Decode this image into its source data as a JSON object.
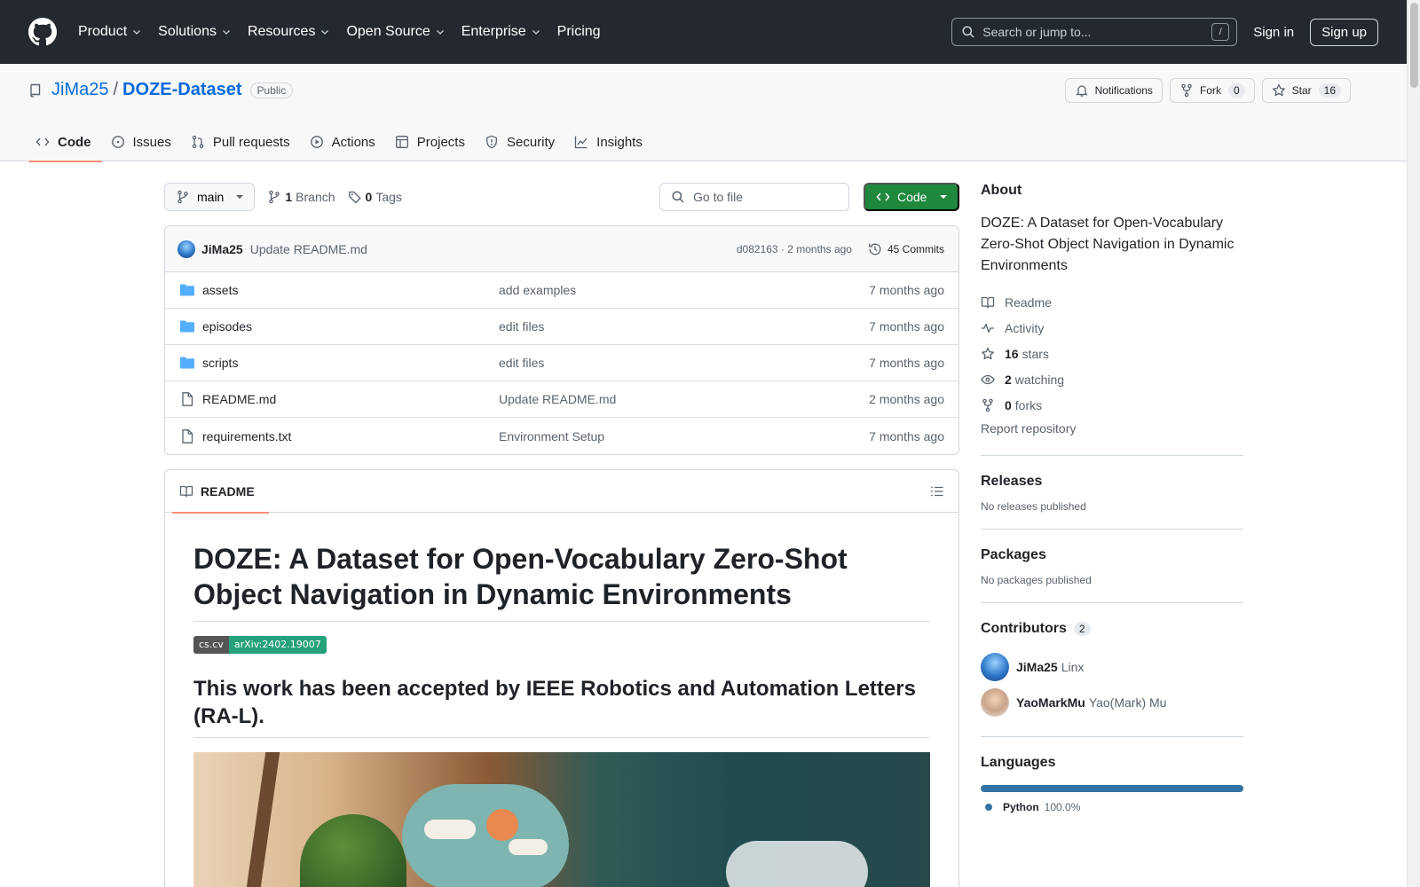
{
  "header": {
    "nav": [
      {
        "label": "Product",
        "has_menu": true
      },
      {
        "label": "Solutions",
        "has_menu": true
      },
      {
        "label": "Resources",
        "has_menu": true
      },
      {
        "label": "Open Source",
        "has_menu": true
      },
      {
        "label": "Enterprise",
        "has_menu": true
      },
      {
        "label": "Pricing",
        "has_menu": false
      }
    ],
    "search_placeholder": "Search or jump to...",
    "search_shortcut": "/",
    "sign_in": "Sign in",
    "sign_up": "Sign up"
  },
  "repo": {
    "owner": "JiMa25",
    "separator": "/",
    "name": "DOZE-Dataset",
    "visibility": "Public",
    "notifications_label": "Notifications",
    "fork_label": "Fork",
    "fork_count": "0",
    "star_label": "Star",
    "star_count": "16",
    "tabs": [
      {
        "label": "Code",
        "icon": "code-icon",
        "active": true
      },
      {
        "label": "Issues",
        "icon": "issue-icon",
        "active": false
      },
      {
        "label": "Pull requests",
        "icon": "pull-request-icon",
        "active": false
      },
      {
        "label": "Actions",
        "icon": "play-icon",
        "active": false
      },
      {
        "label": "Projects",
        "icon": "table-icon",
        "active": false
      },
      {
        "label": "Security",
        "icon": "shield-icon",
        "active": false
      },
      {
        "label": "Insights",
        "icon": "graph-icon",
        "active": false
      }
    ]
  },
  "toolbar": {
    "branch": "main",
    "branch_count": "1",
    "branch_label": "Branch",
    "tag_count": "0",
    "tag_label": "Tags",
    "goto_placeholder": "Go to file",
    "code_button": "Code"
  },
  "commit": {
    "author": "JiMa25",
    "message": "Update README.md",
    "hash_age": "d082163 · 2 months ago",
    "commits_label": "45 Commits"
  },
  "files": [
    {
      "name": "assets",
      "type": "folder",
      "message": "add examples",
      "age": "7 months ago"
    },
    {
      "name": "episodes",
      "type": "folder",
      "message": "edit files",
      "age": "7 months ago"
    },
    {
      "name": "scripts",
      "type": "folder",
      "message": "edit files",
      "age": "7 months ago"
    },
    {
      "name": "README.md",
      "type": "file",
      "message": "Update README.md",
      "age": "2 months ago"
    },
    {
      "name": "requirements.txt",
      "type": "file",
      "message": "Environment Setup",
      "age": "7 months ago"
    }
  ],
  "readme": {
    "tab_label": "README",
    "title": "DOZE: A Dataset for Open-Vocabulary Zero-Shot Object Navigation in Dynamic Environments",
    "badge_left": "cs.cv",
    "badge_right": "arXiv:2402.19007",
    "subtitle": "This work has been accepted by IEEE Robotics and Automation Letters (RA-L)."
  },
  "about": {
    "title": "About",
    "description": "DOZE: A Dataset for Open-Vocabulary Zero-Shot Object Navigation in Dynamic Environments",
    "readme_label": "Readme",
    "activity_label": "Activity",
    "stars_count": "16",
    "stars_label": "stars",
    "watching_count": "2",
    "watching_label": "watching",
    "forks_count": "0",
    "forks_label": "forks",
    "report": "Report repository"
  },
  "releases": {
    "title": "Releases",
    "empty": "No releases published"
  },
  "packages": {
    "title": "Packages",
    "empty": "No packages published"
  },
  "contributors": {
    "title": "Contributors",
    "count": "2",
    "list": [
      {
        "login": "JiMa25",
        "name": "Linx"
      },
      {
        "login": "YaoMarkMu",
        "name": "Yao(Mark) Mu"
      }
    ]
  },
  "languages": {
    "title": "Languages",
    "list": [
      {
        "name": "Python",
        "percent": "100.0%",
        "color": "#3572a5"
      }
    ]
  },
  "colors": {
    "header_bg": "#24292f",
    "link": "#0969da",
    "primary_button": "#1f883d",
    "active_tab_underline": "#fd8c73"
  }
}
